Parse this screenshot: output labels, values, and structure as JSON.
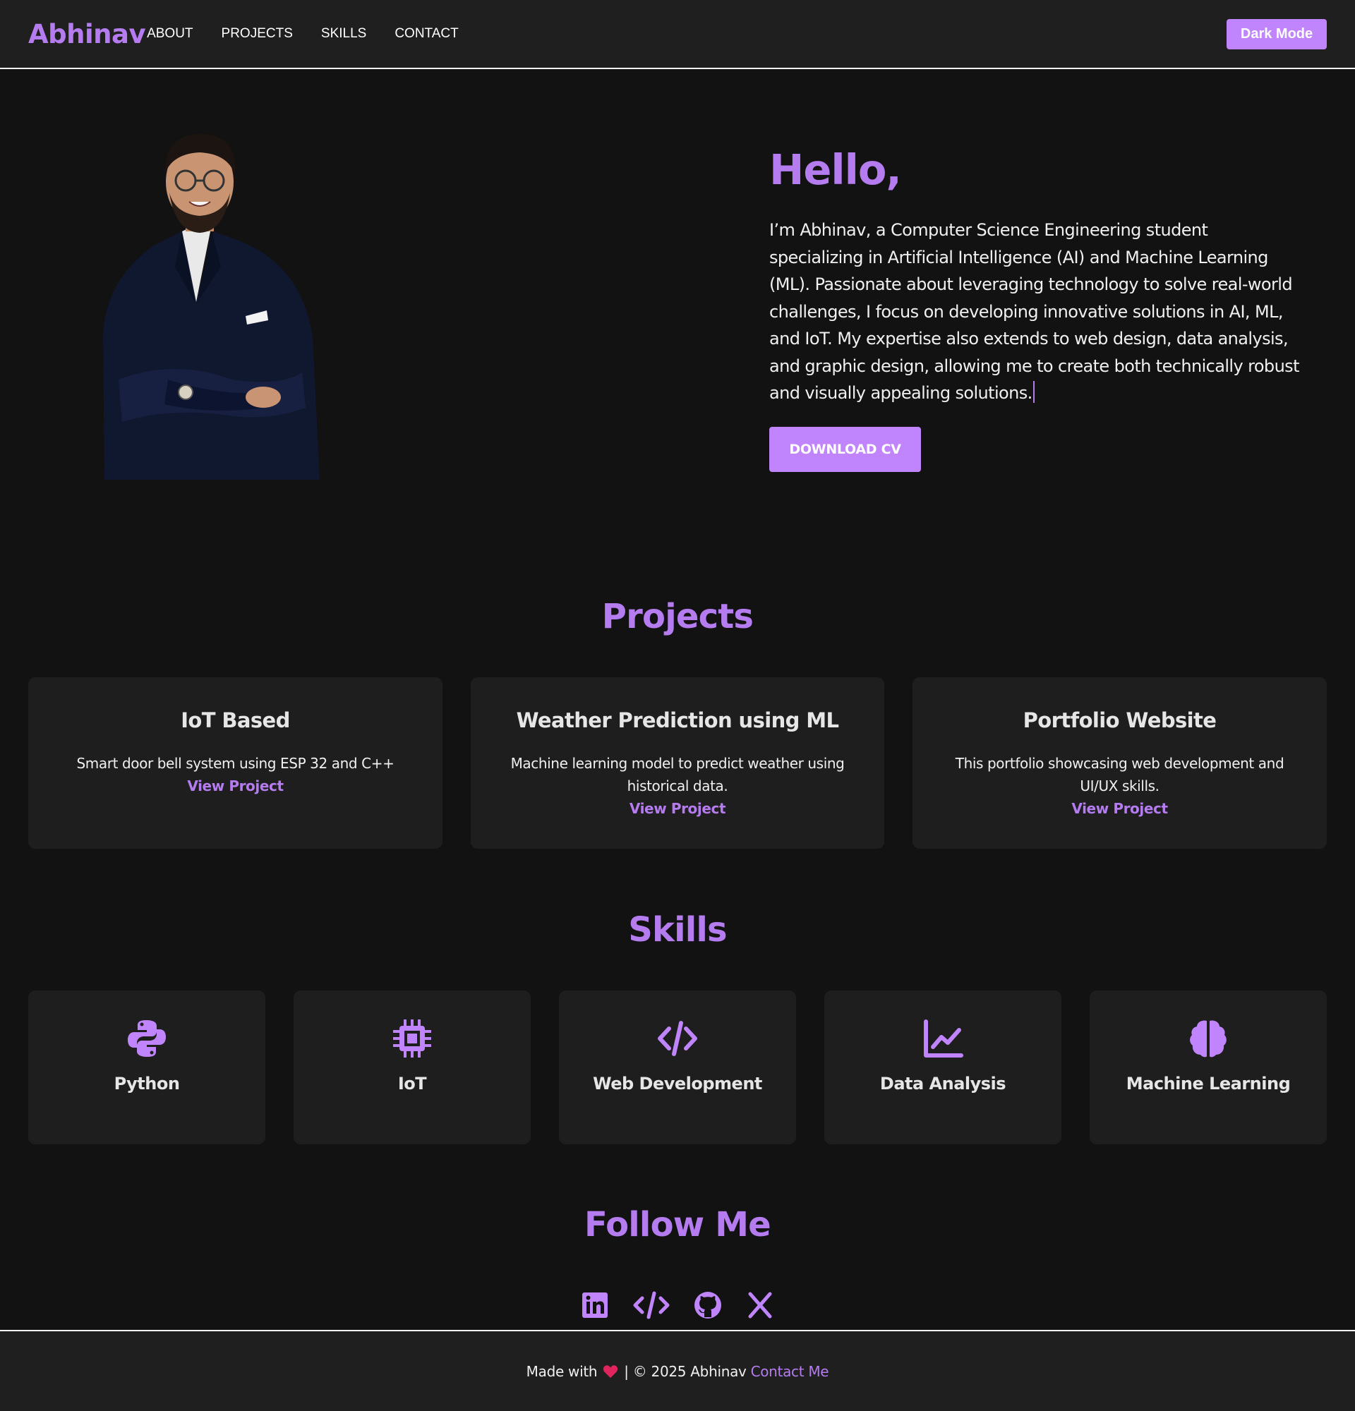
{
  "nav": {
    "brand": "Abhinav",
    "links": [
      "ABOUT",
      "PROJECTS",
      "SKILLS",
      "CONTACT"
    ],
    "dark_mode_label": "Dark Mode"
  },
  "hero": {
    "title": "Hello,",
    "description": "I’m Abhinav, a Computer Science Engineering student specializing in Artificial Intelligence (AI) and Machine Learning (ML). Passionate about leveraging technology to solve real-world challenges, I focus on developing innovative solutions in AI, ML, and IoT. My expertise also extends to web design, data analysis, and graphic design, allowing me to create both technically robust and visually appealing solutions.",
    "cv_button": "DOWNLOAD CV"
  },
  "projects": {
    "title": "Projects",
    "items": [
      {
        "title": "IoT Based",
        "description": "Smart door bell system using ESP 32 and C++",
        "link": "View Project"
      },
      {
        "title": "Weather Prediction using ML",
        "description": "Machine learning model to predict weather using historical data.",
        "link": "View Project"
      },
      {
        "title": "Portfolio Website",
        "description": "This portfolio showcasing web development and UI/UX skills.",
        "link": "View Project"
      }
    ]
  },
  "skills": {
    "title": "Skills",
    "items": [
      {
        "name": "Python",
        "icon": "python-icon"
      },
      {
        "name": "IoT",
        "icon": "microchip-icon"
      },
      {
        "name": "Web Development",
        "icon": "code-icon"
      },
      {
        "name": "Data Analysis",
        "icon": "chart-line-icon"
      },
      {
        "name": "Machine Learning",
        "icon": "brain-icon"
      }
    ]
  },
  "follow": {
    "title": "Follow Me",
    "icons": [
      "linkedin-icon",
      "code-icon",
      "github-icon",
      "x-icon"
    ]
  },
  "footer": {
    "made_with": "Made with",
    "copyright": "| © 2025 Abhinav",
    "contact": "Contact Me"
  },
  "colors": {
    "accent": "#b57cf0",
    "button": "#c084fc",
    "background": "#121212",
    "card": "#1e1e1e",
    "heart": "#e0245e"
  }
}
